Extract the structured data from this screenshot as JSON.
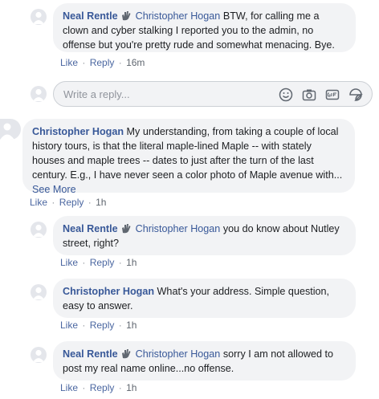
{
  "comments": [
    {
      "author": "Neal Rentle",
      "tagged": "Christopher Hogan",
      "text": "BTW, for calling me a clown and cyber stalking I reported you to the admin, no offense but you're pretty rude and somewhat menacing. Bye.",
      "like": "Like",
      "reply": "Reply",
      "time": "16m"
    },
    {
      "author": "Christopher Hogan",
      "text": "My understanding, from taking a couple of local history tours, is that the literal maple-lined Maple -- with stately houses and maple trees -- dates to just after the turn of the last century. E.g., I have never seen a color photo of Maple avenue with...",
      "see_more": "See More",
      "like": "Like",
      "reply": "Reply",
      "time": "1h"
    },
    {
      "author": "Neal Rentle",
      "tagged": "Christopher Hogan",
      "text": "you do know about Nutley street, right?",
      "like": "Like",
      "reply": "Reply",
      "time": "1h"
    },
    {
      "author": "Christopher Hogan",
      "text": "What's your address. Simple question, easy to answer.",
      "like": "Like",
      "reply": "Reply",
      "time": "1h"
    },
    {
      "author": "Neal Rentle",
      "tagged": "Christopher Hogan",
      "text": "sorry I am not allowed to post my real name online...no offense.",
      "like": "Like",
      "reply": "Reply",
      "time": "1h"
    }
  ],
  "reply_box": {
    "placeholder": "Write a reply...",
    "icons": [
      "emoji-icon",
      "camera-icon",
      "gif-icon",
      "sticker-icon"
    ]
  },
  "separator": "·"
}
